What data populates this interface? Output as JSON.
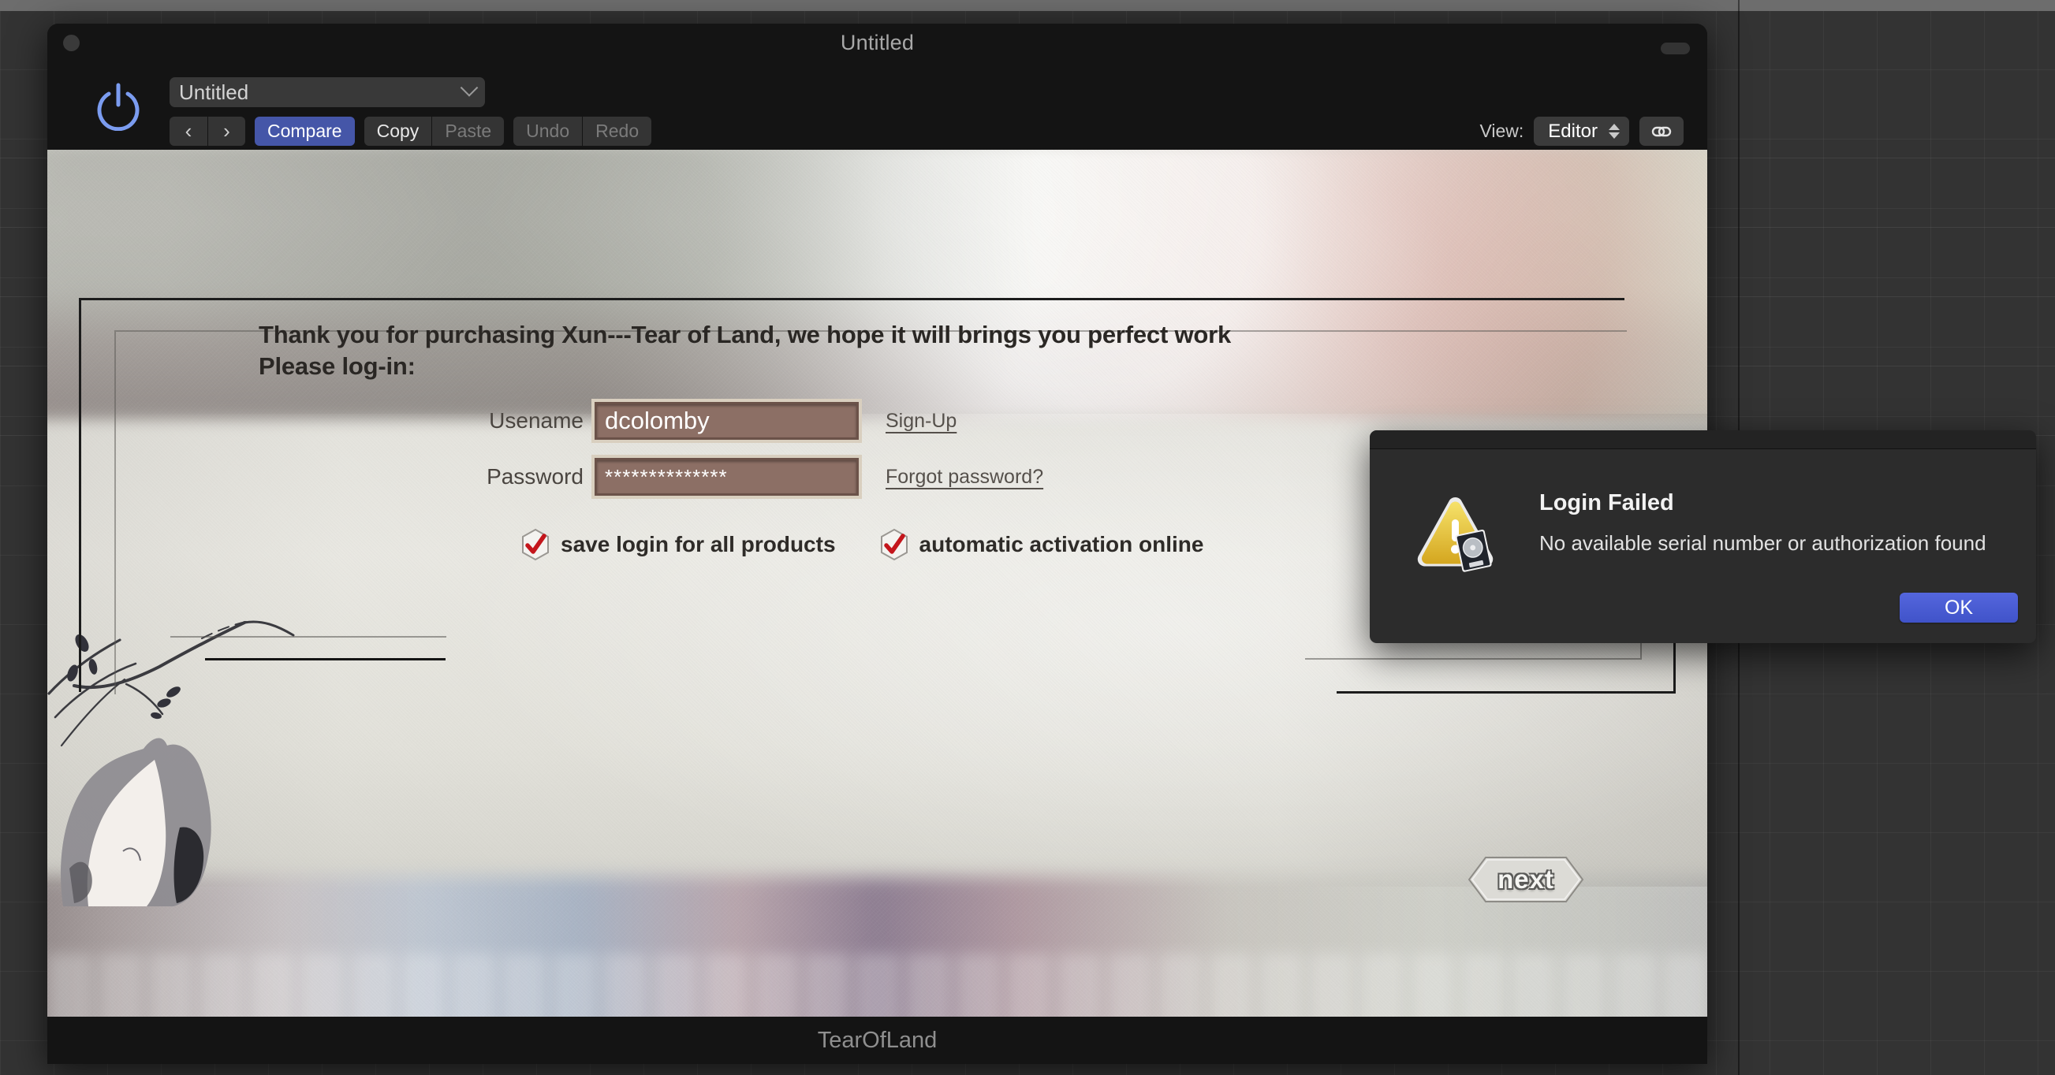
{
  "window": {
    "title": "Untitled",
    "footer_name": "TearOfLand"
  },
  "toolbar": {
    "power_icon": "power-icon",
    "preset_name": "Untitled",
    "preset_chevron_icon": "chevron-down-icon",
    "prev_label": "‹",
    "next_label": "›",
    "compare_label": "Compare",
    "copy_label": "Copy",
    "paste_label": "Paste",
    "undo_label": "Undo",
    "redo_label": "Redo",
    "view_label": "View:",
    "view_value": "Editor",
    "view_stepper_icon": "stepper-updown-icon",
    "link_icon": "link-chain-icon",
    "accent_color": "#4556a8"
  },
  "form": {
    "intro_line1": "Thank you for purchasing Xun---Tear of Land, we hope it will brings you perfect work",
    "intro_line2": "Please log-in:",
    "username_label": "Usename",
    "username_value": "dcolomby",
    "password_label": "Password",
    "password_value": "**************",
    "signup_link": "Sign-Up",
    "forgot_link": "Forgot password?",
    "check1_label": "save login for all products",
    "check2_label": "automatic activation online",
    "next_label": "next",
    "check_mark_color": "#c4161c",
    "field_fill_color": "#8c6f65"
  },
  "dialog": {
    "title": "Login Failed",
    "message": "No available serial number or authorization found",
    "ok_label": "OK",
    "warning_icon": "warning-triangle-icon",
    "ok_color": "#4a5bd4"
  }
}
